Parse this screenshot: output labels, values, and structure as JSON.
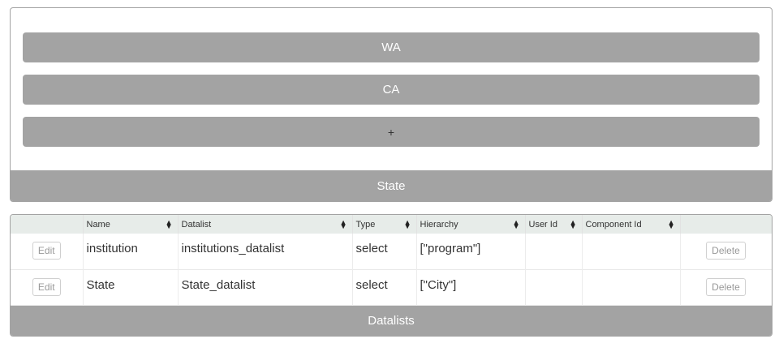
{
  "state_panel": {
    "buttons": [
      "WA",
      "CA"
    ],
    "add_label": "+",
    "footer_title": "State"
  },
  "datalists": {
    "columns": [
      "",
      "Name",
      "Datalist",
      "Type",
      "Hierarchy",
      "User Id",
      "Component Id",
      ""
    ],
    "rows": [
      {
        "edit_label": "Edit",
        "name": "institution",
        "datalist": "institutions_datalist",
        "type": "select",
        "hierarchy": "[\"program\"]",
        "user_id": "",
        "component_id": "",
        "delete_label": "Delete"
      },
      {
        "edit_label": "Edit",
        "name": "State",
        "datalist": "State_datalist",
        "type": "select",
        "hierarchy": "[\"City\"]",
        "user_id": "",
        "component_id": "",
        "delete_label": "Delete"
      }
    ],
    "footer_title": "Datalists"
  },
  "colors": {
    "panel_gray": "#a3a3a3",
    "header_bg": "#e7ece9"
  },
  "icons": {
    "sort": "sort-icon"
  }
}
